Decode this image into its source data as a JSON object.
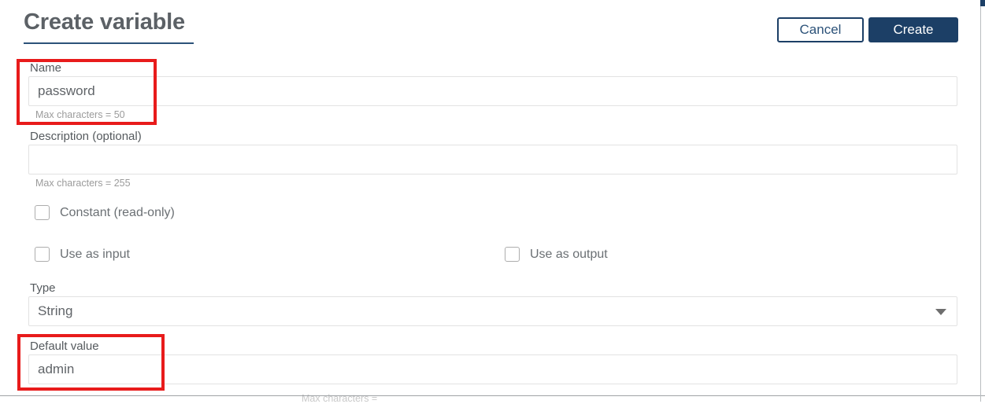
{
  "header": {
    "title": "Create variable",
    "cancel_label": "Cancel",
    "create_label": "Create"
  },
  "form": {
    "name": {
      "label": "Name",
      "value": "password",
      "placeholder": "",
      "hint": "Max characters = 50"
    },
    "description": {
      "label": "Description (optional)",
      "value": "",
      "placeholder": "",
      "hint": "Max characters = 255"
    },
    "constant": {
      "label": "Constant (read-only)",
      "checked": false
    },
    "use_as_input": {
      "label": "Use as input",
      "checked": false
    },
    "use_as_output": {
      "label": "Use as output",
      "checked": false
    },
    "type": {
      "label": "Type",
      "value": "String",
      "options": [
        "String"
      ]
    },
    "default_value": {
      "label": "Default value",
      "value": "admin",
      "placeholder": "",
      "hint": "Max characters ="
    }
  },
  "annotations": [
    {
      "name": "name-field-highlight",
      "color": "#e81b1b"
    },
    {
      "name": "default-value-field-highlight",
      "color": "#e81b1b"
    }
  ]
}
